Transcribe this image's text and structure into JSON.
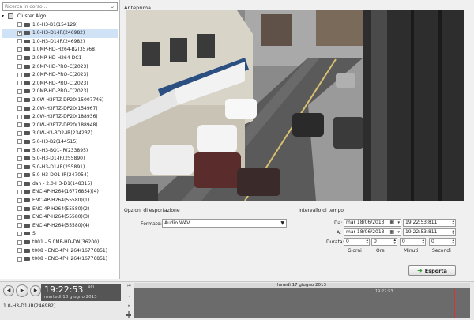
{
  "search": {
    "placeholder": "Ricerca in corso...",
    "icon": "search-icon"
  },
  "tree": {
    "root": "Cluster Algo",
    "items": [
      {
        "label": "1.0-H3-B1(154129)",
        "checked": false,
        "selected": false
      },
      {
        "label": "1.0-H3-D1-IR(246982)",
        "checked": true,
        "selected": true
      },
      {
        "label": "1.0-H3-D1-IR(246982)",
        "checked": false,
        "selected": false
      },
      {
        "label": "1.0MP-HD-H264-B2(35768)",
        "checked": false,
        "selected": false
      },
      {
        "label": "2.0MP-HD-H264-DC1",
        "checked": false,
        "selected": false
      },
      {
        "label": "2.0MP-HD-PRO-C(2023)",
        "checked": false,
        "selected": false
      },
      {
        "label": "2.0MP-HD-PRO-C(2023)",
        "checked": false,
        "selected": false
      },
      {
        "label": "2.0MP-HD-PRO-C(2023)",
        "checked": false,
        "selected": false
      },
      {
        "label": "2.0MP-HD-PRO-C(2023)",
        "checked": false,
        "selected": false
      },
      {
        "label": "2.0W-H3PTZ-DP20(15007746)",
        "checked": false,
        "selected": false
      },
      {
        "label": "2.0W-H3PTZ-DP20(154967)",
        "checked": false,
        "selected": false
      },
      {
        "label": "2.0W-H3PTZ-DP20(188936)",
        "checked": false,
        "selected": false
      },
      {
        "label": "2.0W-H3PTZ-DP20(188948)",
        "checked": false,
        "selected": false
      },
      {
        "label": "3.0W-H3-BO2-IR(234237)",
        "checked": false,
        "selected": false
      },
      {
        "label": "5.0-H3-B2(144515)",
        "checked": false,
        "selected": false
      },
      {
        "label": "5.0-H3-BO1-IR(233895)",
        "checked": false,
        "selected": false
      },
      {
        "label": "5.0-H3-D1-IR(255890)",
        "checked": false,
        "selected": false
      },
      {
        "label": "5.0-H3-D1-IR(255891)",
        "checked": false,
        "selected": false
      },
      {
        "label": "5.0-H3-DO1-IR(247054)",
        "checked": false,
        "selected": false
      },
      {
        "label": "dan - 2.0-H3-D1(148315)",
        "checked": false,
        "selected": false
      },
      {
        "label": "ENC-4P-H264(16776854)(4)",
        "checked": false,
        "selected": false
      },
      {
        "label": "ENC-4P-H264(55580)(1)",
        "checked": false,
        "selected": false
      },
      {
        "label": "ENC-4P-H264(55580)(2)",
        "checked": false,
        "selected": false
      },
      {
        "label": "ENC-4P-H264(55580)(3)",
        "checked": false,
        "selected": false
      },
      {
        "label": "ENC-4P-H264(55580)(4)",
        "checked": false,
        "selected": false
      },
      {
        "label": "S",
        "checked": false,
        "selected": false
      },
      {
        "label": "t001 - 5.0MP-HD-DN(36200)",
        "checked": false,
        "selected": false
      },
      {
        "label": "t008 - ENC-4P-H264(16776851)",
        "checked": false,
        "selected": false
      },
      {
        "label": "t008 - ENC-4P-H264(16776851)",
        "checked": false,
        "selected": false
      }
    ]
  },
  "preview": {
    "label": "Anteprima"
  },
  "export_options": {
    "title": "Opzioni di esportazione",
    "format_label": "Formato:",
    "format_value": "Audio WAV"
  },
  "interval": {
    "title": "Intervallo di tempo",
    "from_label": "Da:",
    "from_date": "mar 18/06/2013",
    "from_time": "19:22:53:811",
    "to_label": "A:",
    "to_date": "mar 18/06/2013",
    "to_time": "19:22:53:811",
    "duration_label": "Durata:",
    "d_days": "0",
    "d_hours": "0",
    "d_minutes": "0",
    "d_seconds": "0",
    "days_label": "Giorni",
    "hours_label": "Ore",
    "minutes_label": "Minuti",
    "seconds_label": "Secondi"
  },
  "export_button": "Esporta",
  "player": {
    "time": "19:22:53",
    "ms": "811",
    "date": "martedì 18 giugno 2013",
    "camera": "1.0-H3-D1-IR(246982)"
  },
  "timeline": {
    "date": "lunedì 17 giugno 2013",
    "time": "19:22:53"
  },
  "colors": {
    "selection": "#cfe2f6",
    "export_arrow": "#2e9b2e",
    "timeline_cursor": "#e03030"
  }
}
